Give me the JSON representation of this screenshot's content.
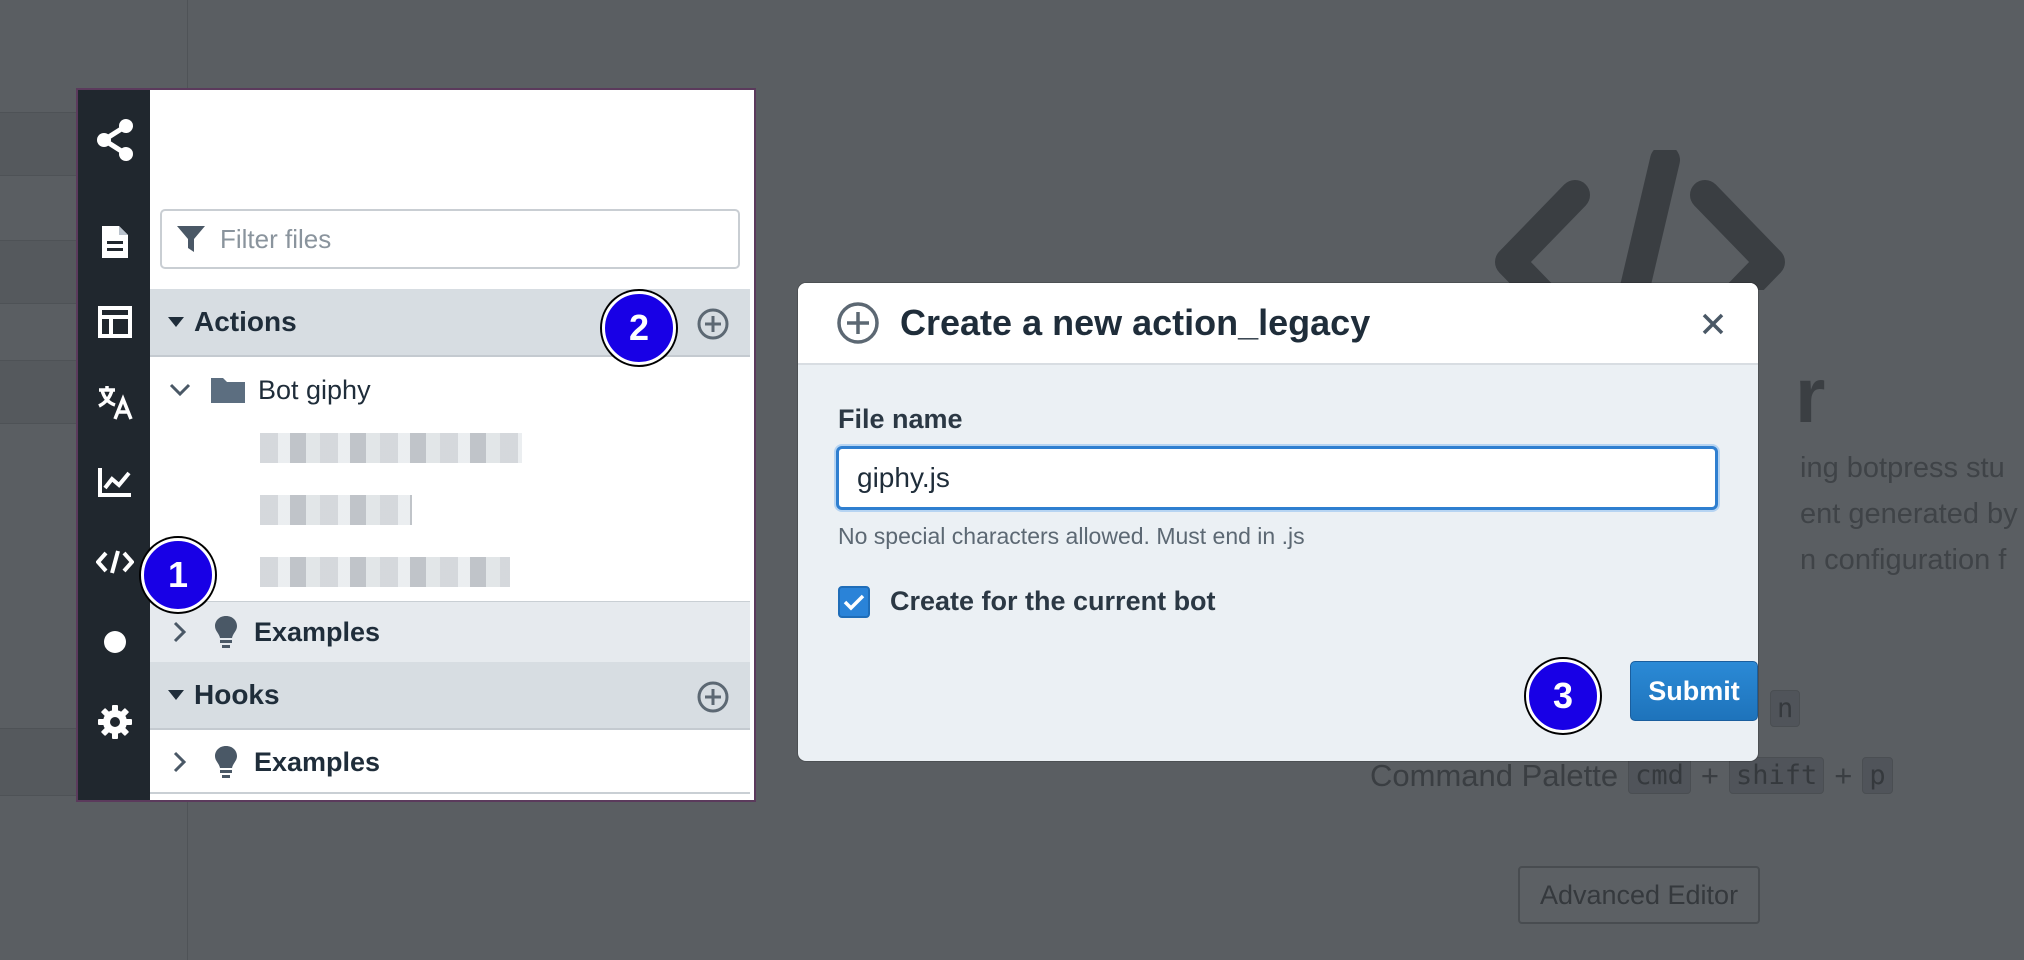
{
  "background": {
    "title_fragment": "r",
    "description_lines": [
      "ing botpress stu",
      "ent generated by",
      "n configuration f"
    ],
    "shortcut_key_solo": "n",
    "command_palette": {
      "label": "Command Palette",
      "keys": [
        "cmd",
        "shift",
        "p"
      ],
      "separator": "+"
    },
    "advanced_editor_label": "Advanced Editor"
  },
  "sidebar": {
    "icons": [
      "share-network-icon",
      "document-icon",
      "layout-icon",
      "translate-icon",
      "analytics-chart-icon",
      "code-editor-icon",
      "circle-dot-icon",
      "gear-icon"
    ]
  },
  "explorer": {
    "filter_placeholder": "Filter files",
    "actions": {
      "title": "Actions",
      "folder_label": "Bot giphy",
      "examples_label": "Examples"
    },
    "hooks": {
      "title": "Hooks",
      "examples_label": "Examples"
    }
  },
  "markers": [
    "1",
    "2",
    "3"
  ],
  "modal": {
    "title": "Create a new action_legacy",
    "file_name_label": "File name",
    "file_name_value": "giphy.js",
    "help_text": "No special characters allowed. Must end in .js",
    "checkbox_checked": true,
    "checkbox_label": "Create for the current bot",
    "submit_label": "Submit"
  },
  "colors": {
    "marker": "#1800e6",
    "primary_button": "#1e73bb",
    "sidebar": "#20272e"
  }
}
